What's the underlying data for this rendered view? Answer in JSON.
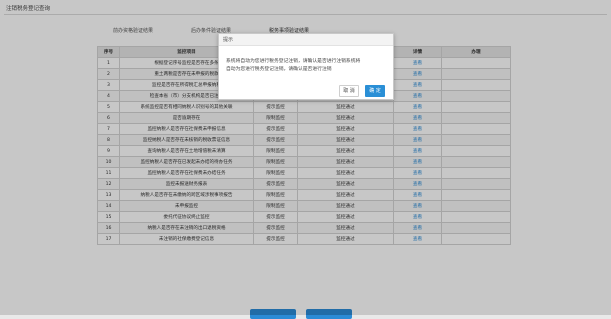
{
  "page": {
    "title": "注销税务登记查询"
  },
  "tabs": [
    {
      "label": "前办资格验证结果"
    },
    {
      "label": "后办条件验证结果"
    },
    {
      "label": "税务事项验证结果"
    }
  ],
  "table": {
    "headers": [
      "序号",
      "监控项目",
      "",
      "",
      "详情",
      "办理"
    ],
    "rows": [
      {
        "no": "1",
        "item": "根据登记序号监控是否存在多条",
        "type": "",
        "result": "",
        "detail": "查看"
      },
      {
        "no": "2",
        "item": "重土两税是否存在未申报的税款",
        "type": "",
        "result": "",
        "detail": "查看"
      },
      {
        "no": "3",
        "item": "监控是否存在所得税汇总申报纳税",
        "type": "",
        "result": "",
        "detail": "查看"
      },
      {
        "no": "4",
        "item": "检查本省（市）分支机构是否已注销",
        "type": "限制监控",
        "result": "监控通过",
        "detail": "查看"
      },
      {
        "no": "5",
        "item": "系统监控是否有相同纳税人识别号的其他关联",
        "type": "提示监控",
        "result": "监控通过",
        "detail": "查看"
      },
      {
        "no": "6",
        "item": "是否逾期存在",
        "type": "限制监控",
        "result": "监控通过",
        "detail": "查看"
      },
      {
        "no": "7",
        "item": "监控纳税人是否存在社保费未申报信息",
        "type": "提示监控",
        "result": "监控通过",
        "detail": "查看"
      },
      {
        "no": "8",
        "item": "监控纳税人是否存在未核销的税收票证信息",
        "type": "提示监控",
        "result": "监控通过",
        "detail": "查看"
      },
      {
        "no": "9",
        "item": "查询纳税人是否存在土地增值税未清算",
        "type": "限制监控",
        "result": "监控通过",
        "detail": "查看"
      },
      {
        "no": "10",
        "item": "监控纳税人是否存在已发起未办结的待办任务",
        "type": "限制监控",
        "result": "监控通过",
        "detail": "查看"
      },
      {
        "no": "11",
        "item": "监控纳税人是否存在社保费未办结任务",
        "type": "限制监控",
        "result": "监控通过",
        "detail": "查看"
      },
      {
        "no": "12",
        "item": "监控未报送财务报表",
        "type": "提示监控",
        "result": "监控通过",
        "detail": "查看"
      },
      {
        "no": "13",
        "item": "纳税人是否存在未缴纳的跨区域涉税事项报告",
        "type": "限制监控",
        "result": "监控通过",
        "detail": "查看"
      },
      {
        "no": "14",
        "item": "未申报监控",
        "type": "限制监控",
        "result": "监控通过",
        "detail": "查看"
      },
      {
        "no": "15",
        "item": "委托代征协议终止监控",
        "type": "提示监控",
        "result": "监控通过",
        "detail": "查看"
      },
      {
        "no": "16",
        "item": "纳税人是否存在未注销的出口退税资格",
        "type": "提示监控",
        "result": "监控通过",
        "detail": "查看"
      },
      {
        "no": "17",
        "item": "未注销的社保缴费登记信息",
        "type": "提示监控",
        "result": "监控通过",
        "detail": "查看"
      }
    ]
  },
  "dialog": {
    "title": "提示",
    "line1": "系统将自动为您进行税务登记注销，请确认是否进行注销系统将",
    "line2": "自动为您进行税务登记注销，请确认是否进行注销",
    "cancel": "取 消",
    "ok": "确 定"
  },
  "colors": {
    "accent": "#2b8bd6"
  }
}
